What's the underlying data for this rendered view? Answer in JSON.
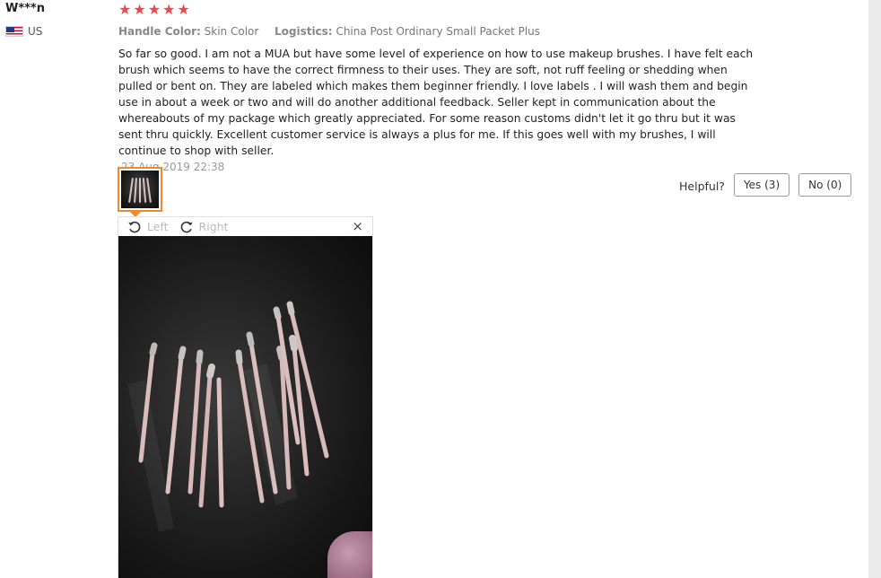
{
  "user": {
    "name": "W***n",
    "country": "US"
  },
  "review": {
    "rating": 5,
    "attributes": [
      {
        "key": "Handle Color:",
        "value": "Skin Color"
      },
      {
        "key": "Logistics:",
        "value": "China Post Ordinary Small Packet Plus"
      }
    ],
    "text": "So far so good. I am not a MUA but have some level of experience on how to use makeup brushes. I have felt each brush which seems to have the correct firmness to their uses. They are soft, not ruff feeling or shedding when pulled or bent on. They are labeled which makes them beginner friendly. I love labels . I will wash them and begin use in about a week or two and will do another additional feedback. Seller kept in communication about the whereabouts of my package which greatly appreciated. For some reason customs didn't let it go thru but it was sent thru quickly. Excellent customer service is always a plus for me. If this goes well with my brushes, I will continue to shop with seller.",
    "date": "23 Aug 2019 22:38"
  },
  "helpful": {
    "label": "Helpful?",
    "yes_label": "Yes (3)",
    "no_label": "No (0)"
  },
  "viewer": {
    "rotate_left_label": "Left",
    "rotate_right_label": "Right",
    "close_symbol": "×"
  },
  "colors": {
    "star": "#f04848",
    "thumb_border": "#f08a2c"
  },
  "icons": {
    "star": "star-icon",
    "flag": "us-flag-icon",
    "rotate_left": "rotate-left-icon",
    "rotate_right": "rotate-right-icon",
    "close": "close-icon"
  }
}
